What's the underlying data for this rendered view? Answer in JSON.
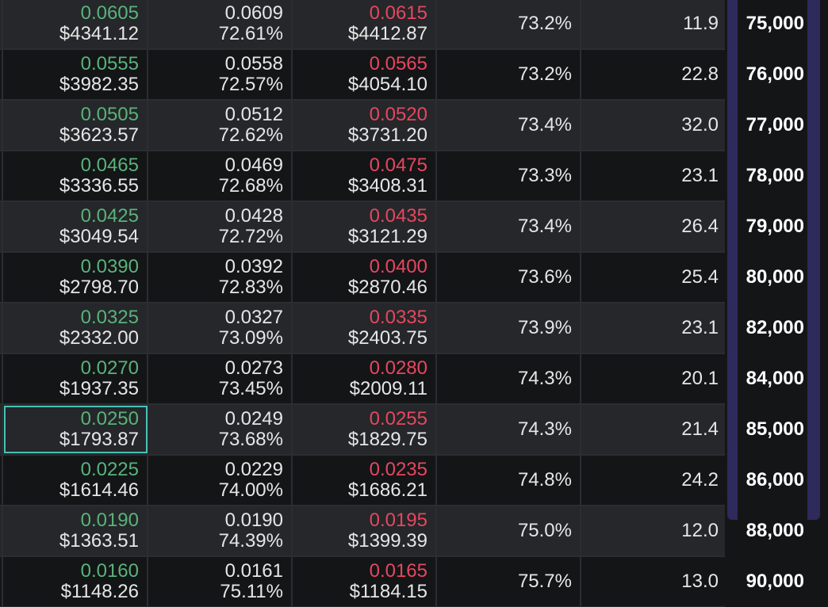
{
  "colors": {
    "bid": "#59b37a",
    "ask": "#e5475f",
    "row_light": "#25272a",
    "row_dark": "#141517",
    "selection": "#47c2b4",
    "strike_band": "#2e2a5b"
  },
  "rows": [
    {
      "bid": "0.0605",
      "bid_usd": "$4341.12",
      "mark": "0.0609",
      "mark_iv": "72.61%",
      "ask": "0.0615",
      "ask_usd": "$4412.87",
      "iv": "73.2%",
      "size": "11.9",
      "strike": "75,000"
    },
    {
      "bid": "0.0555",
      "bid_usd": "$3982.35",
      "mark": "0.0558",
      "mark_iv": "72.57%",
      "ask": "0.0565",
      "ask_usd": "$4054.10",
      "iv": "73.2%",
      "size": "22.8",
      "strike": "76,000"
    },
    {
      "bid": "0.0505",
      "bid_usd": "$3623.57",
      "mark": "0.0512",
      "mark_iv": "72.62%",
      "ask": "0.0520",
      "ask_usd": "$3731.20",
      "iv": "73.4%",
      "size": "32.0",
      "strike": "77,000"
    },
    {
      "bid": "0.0465",
      "bid_usd": "$3336.55",
      "mark": "0.0469",
      "mark_iv": "72.68%",
      "ask": "0.0475",
      "ask_usd": "$3408.31",
      "iv": "73.3%",
      "size": "23.1",
      "strike": "78,000"
    },
    {
      "bid": "0.0425",
      "bid_usd": "$3049.54",
      "mark": "0.0428",
      "mark_iv": "72.72%",
      "ask": "0.0435",
      "ask_usd": "$3121.29",
      "iv": "73.4%",
      "size": "26.4",
      "strike": "79,000"
    },
    {
      "bid": "0.0390",
      "bid_usd": "$2798.70",
      "mark": "0.0392",
      "mark_iv": "72.83%",
      "ask": "0.0400",
      "ask_usd": "$2870.46",
      "iv": "73.6%",
      "size": "25.4",
      "strike": "80,000"
    },
    {
      "bid": "0.0325",
      "bid_usd": "$2332.00",
      "mark": "0.0327",
      "mark_iv": "73.09%",
      "ask": "0.0335",
      "ask_usd": "$2403.75",
      "iv": "73.9%",
      "size": "23.1",
      "strike": "82,000"
    },
    {
      "bid": "0.0270",
      "bid_usd": "$1937.35",
      "mark": "0.0273",
      "mark_iv": "73.45%",
      "ask": "0.0280",
      "ask_usd": "$2009.11",
      "iv": "74.3%",
      "size": "20.1",
      "strike": "84,000"
    },
    {
      "bid": "0.0250",
      "bid_usd": "$1793.87",
      "mark": "0.0249",
      "mark_iv": "73.68%",
      "ask": "0.0255",
      "ask_usd": "$1829.75",
      "iv": "74.3%",
      "size": "21.4",
      "strike": "85,000",
      "selected": true
    },
    {
      "bid": "0.0225",
      "bid_usd": "$1614.46",
      "mark": "0.0229",
      "mark_iv": "74.00%",
      "ask": "0.0235",
      "ask_usd": "$1686.21",
      "iv": "74.8%",
      "size": "24.2",
      "strike": "86,000"
    },
    {
      "bid": "0.0190",
      "bid_usd": "$1363.51",
      "mark": "0.0190",
      "mark_iv": "74.39%",
      "ask": "0.0195",
      "ask_usd": "$1399.39",
      "iv": "75.0%",
      "size": "12.0",
      "strike": "88,000"
    },
    {
      "bid": "0.0160",
      "bid_usd": "$1148.26",
      "mark": "0.0161",
      "mark_iv": "75.11%",
      "ask": "0.0165",
      "ask_usd": "$1184.15",
      "iv": "75.7%",
      "size": "13.0",
      "strike": "90,000"
    }
  ]
}
